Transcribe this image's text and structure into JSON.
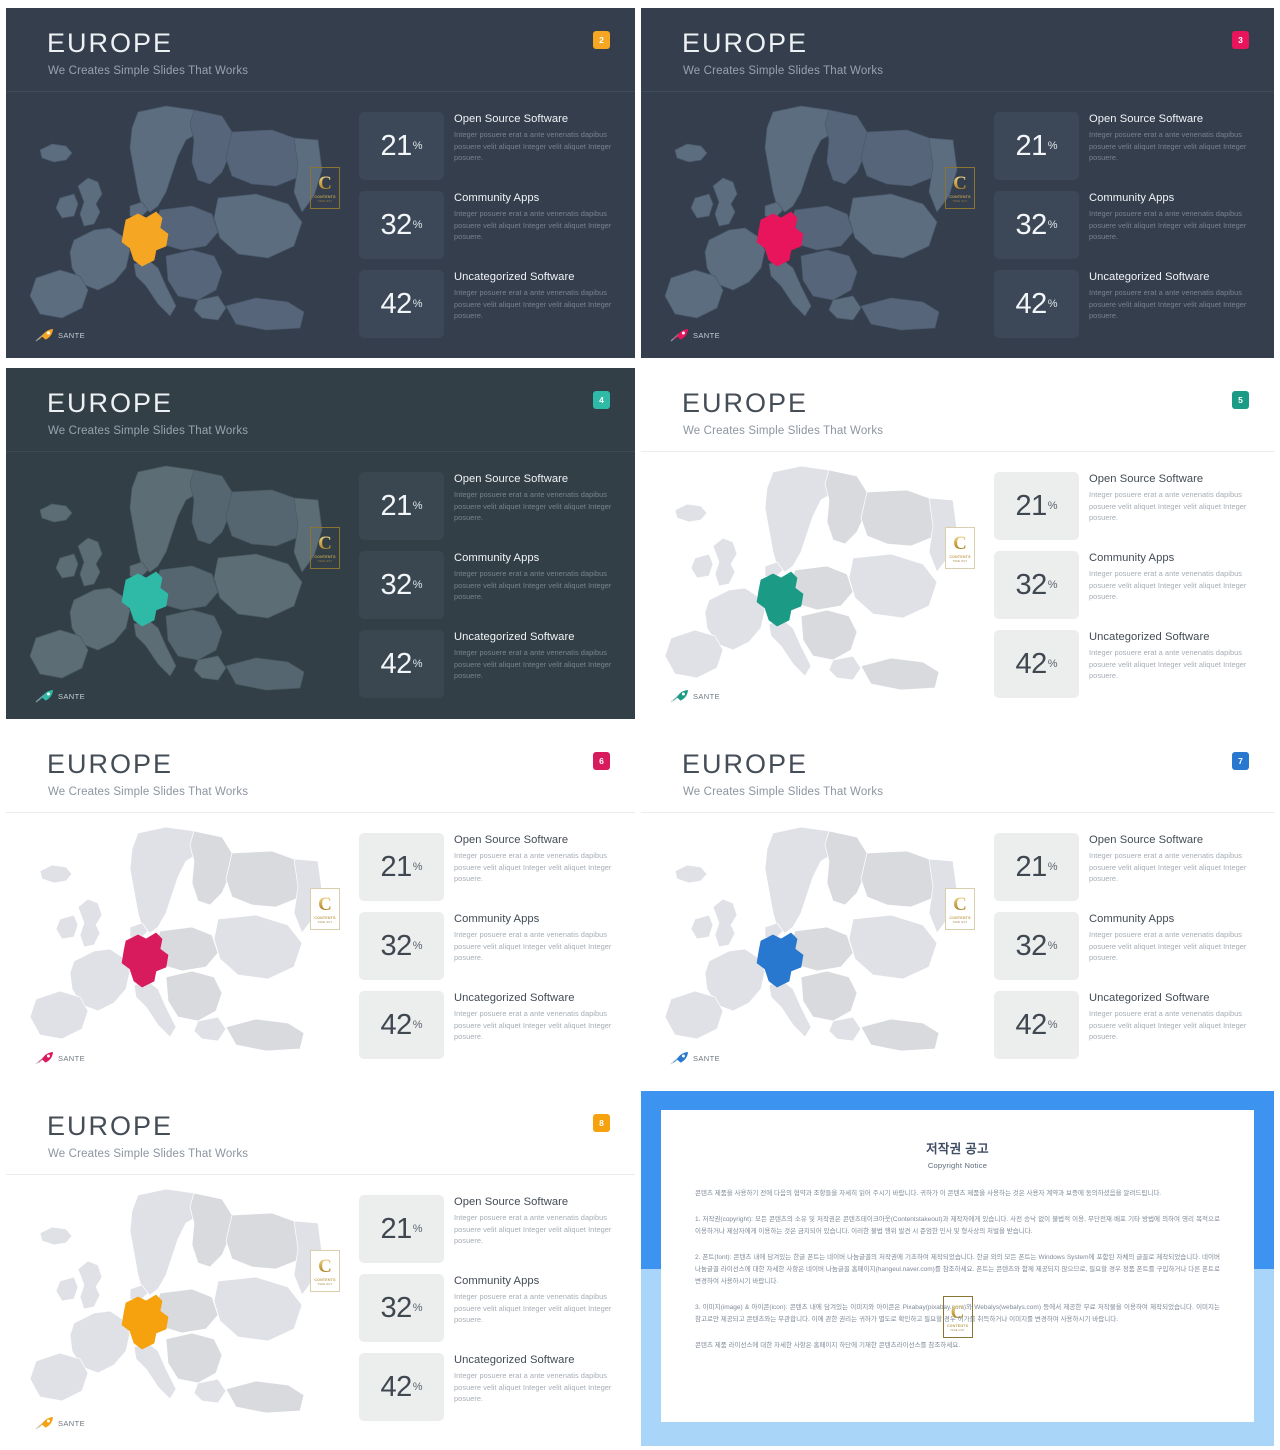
{
  "common": {
    "title": "EUROPE",
    "subtitle": "We Creates Simple Slides That Works",
    "brand": {
      "label": "SANTE",
      "icon": "rocket-icon"
    },
    "contents_logo": {
      "glyph": "C",
      "line1": "CONTENTS",
      "line2": "TAKE OUT"
    },
    "stats": [
      {
        "value": "21",
        "unit": "%",
        "title": "Open Source Software",
        "body": "Integer posuere erat a ante venenatis dapibus posuere velit aliquet Integer velit aliquet Integer posuere."
      },
      {
        "value": "32",
        "unit": "%",
        "title": "Community Apps",
        "body": "Integer posuere erat a ante venenatis dapibus posuere velit aliquet Integer velit aliquet Integer posuere."
      },
      {
        "value": "42",
        "unit": "%",
        "title": "Uncategorized Software",
        "body": "Integer posuere erat a ante venenatis dapibus posuere velit aliquet Integer velit aliquet Integer posuere."
      }
    ],
    "map": {
      "name": "europe-map",
      "highlighted_country": "Germany"
    }
  },
  "slides": [
    {
      "badge": "2",
      "theme": "dark",
      "accent": "#f5a623",
      "map_base": "#5d6d80",
      "map_alt": "#56657a",
      "map_line": "#49586b"
    },
    {
      "badge": "3",
      "theme": "dark",
      "accent": "#e8155c",
      "map_base": "#5d6d80",
      "map_alt": "#56657a",
      "map_line": "#49586b"
    },
    {
      "badge": "4",
      "theme": "dark2",
      "accent": "#2ebaa6",
      "map_base": "#5c6d76",
      "map_alt": "#556670",
      "map_line": "#4a5a63"
    },
    {
      "badge": "5",
      "theme": "light",
      "accent": "#1b9b86",
      "map_base": "#dfe1e6",
      "map_alt": "#d8dade",
      "map_line": "#ffffff"
    },
    {
      "badge": "6",
      "theme": "light",
      "accent": "#d81b5c",
      "map_base": "#dfe1e6",
      "map_alt": "#d8dade",
      "map_line": "#ffffff"
    },
    {
      "badge": "7",
      "theme": "light",
      "accent": "#2878d0",
      "map_base": "#dfe1e6",
      "map_alt": "#d8dade",
      "map_line": "#ffffff"
    },
    {
      "badge": "8",
      "theme": "light",
      "accent": "#f6a10e",
      "map_base": "#dfe1e6",
      "map_alt": "#d8dade",
      "map_line": "#ffffff"
    }
  ],
  "copyright": {
    "heading_ko": "저작권 공고",
    "heading_en": "Copyright Notice",
    "paragraphs": [
      "콘텐츠 제품을 사용하기 전에 다음의 협약과 조항들을 자세히 읽어 주시기 바랍니다. 귀하가 이 콘텐츠 제품을 사용하는 것은 사용자 계약과 보증에 동의하셨음을 알려드립니다.",
      "1. 저작권(copyright): 모든 콘텐츠의 소유 및 저작권은 콘텐츠테이크아웃(Contentstakeout)과 제작자에게 있습니다. 사전 승낙 없이 불법적 이용, 무단전재·배포 기타 방법에 의하여 영리 목적으로 이용하거나 제삼자에게 이용하는 것은 금지되어 있습니다. 이러한 불법 행위 발견 시 준엄한 민사 및 형사상의 처벌을 받습니다.",
      "2. 폰트(font): 콘텐츠 내에 담겨있는 한글 폰트는 네이버 나눔글꼴의 저작권에 기초하여 제작되었습니다. 한글 외의 모든 폰트는 Windows System에 포함된 자체의 글꼴로 제작되었습니다. 네이버 나눔글꼴 라이선스에 대한 자세한 사항은 네이버 나눔글꼴 홈페이지(hangeul.naver.com)를 참조하세요. 폰트는 콘텐츠와 함께 제공되지 않으므로, 필요할 경우 정품 폰트를 구입하거나 다른 폰트로 변경하여 사용하시기 바랍니다.",
      "3. 이미지(image) & 아이콘(icon): 콘텐츠 내에 담겨있는 이미지와 아이콘은 Pixabay(pixabay.com)와 Webalys(webalys.com) 등에서 제공한 무료 저작물을 이용하여 제작되었습니다. 이미지는 참고로만 제공되고 콘텐츠와는 무관합니다. 이에 관한 권리는 귀하가 별도로 확인하고 필요할 경우 허가를 취득하거나 이미지를 변경하여 사용하시기 바랍니다.",
      "콘텐츠 제품 라이선스에 대한 자세한 사항은 홈페이지 하단에 기재한 콘텐츠라이선스를 참조하세요."
    ]
  }
}
